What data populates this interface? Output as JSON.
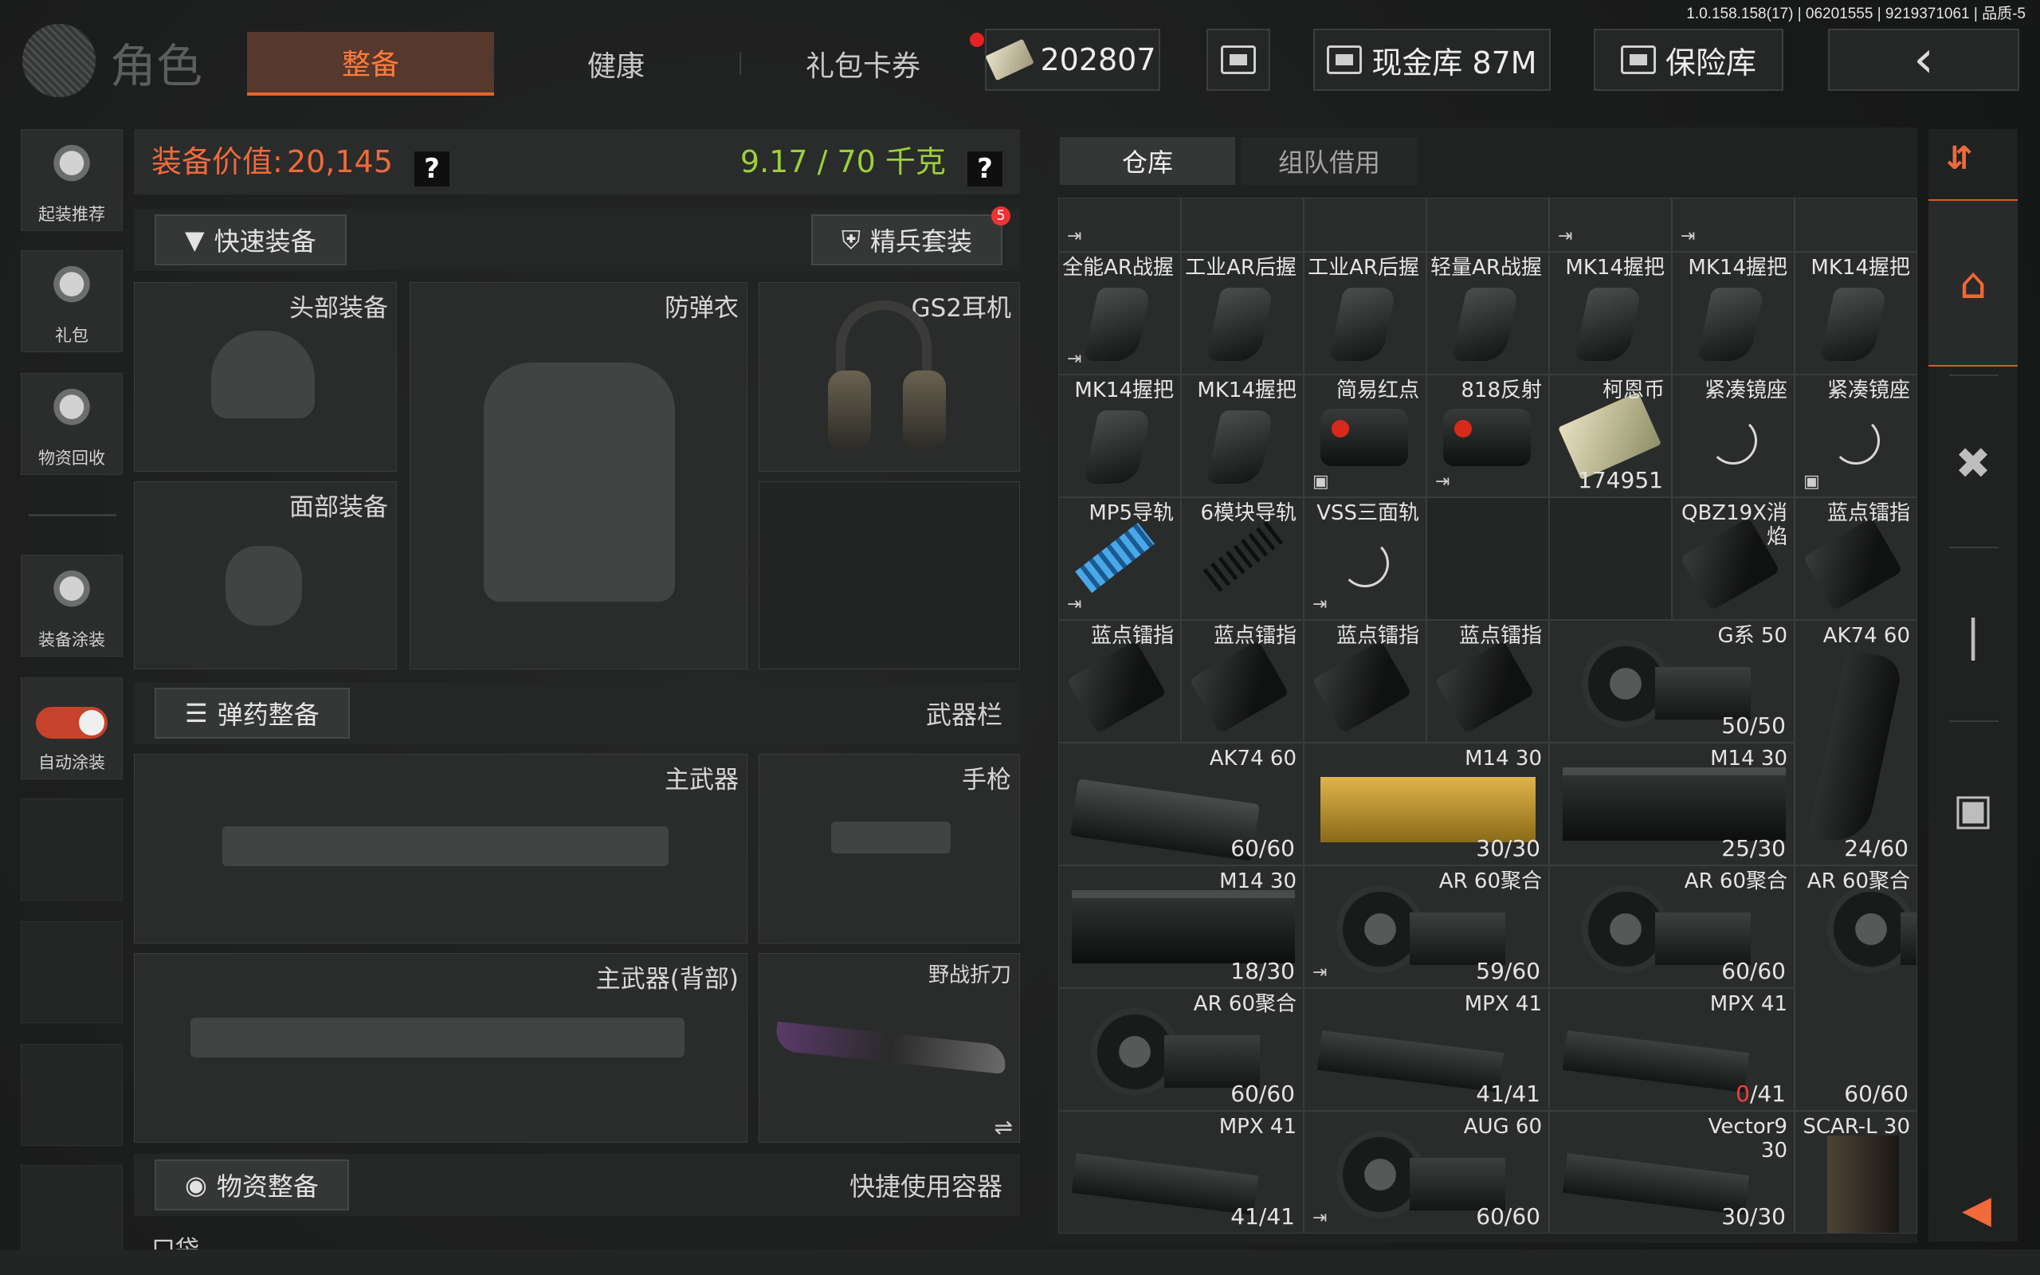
{
  "version": "1.0.158.158(17) | 06201555 | 9219371061 | 品质-5",
  "header": {
    "title": "角色",
    "tabs": [
      {
        "label": "整备",
        "active": true
      },
      {
        "label": "健康",
        "active": false
      },
      {
        "label": "礼包卡券",
        "active": false
      }
    ],
    "currency": "202807",
    "cash_vault": "现金库 87M",
    "safe": "保险库"
  },
  "sidebar": {
    "items": [
      {
        "label": "起装推荐",
        "icon": "loadout-icon"
      },
      {
        "label": "礼包",
        "icon": "gift-icon"
      },
      {
        "label": "物资回收",
        "icon": "recycle-icon"
      },
      {
        "label": "装备涂装",
        "icon": "paint-icon"
      },
      {
        "label": "自动涂装",
        "icon": "toggle-icon",
        "toggle_on": true
      }
    ]
  },
  "loadout": {
    "value_label": "装备价值:",
    "value": "20,145",
    "weight": "9.17 / 70 千克",
    "help": "?",
    "quick_equip": "快速装备",
    "elite_set": "精兵套装",
    "elite_badge": "5",
    "slots": {
      "head": "头部装备",
      "armor": "防弹衣",
      "headset": "GS2耳机",
      "face": "面部装备"
    },
    "ammo_button": "弹药整备",
    "weapon_bar": "武器栏",
    "primary": "主武器",
    "pistol": "手枪",
    "primary_back": "主武器(背部)",
    "knife": "野战折刀",
    "swap_icon": "⇌",
    "supply_button": "物资整备",
    "quick_container": "快捷使用容器",
    "pocket": "口袋"
  },
  "storage": {
    "tabs": [
      {
        "label": "仓库",
        "active": true
      },
      {
        "label": "组队借用",
        "active": false
      }
    ],
    "items": [
      {
        "name": "全能AR战握",
        "count": "",
        "art": "grip",
        "corner": "tr"
      },
      {
        "name": "工业AR后握",
        "count": "",
        "art": "grip"
      },
      {
        "name": "工业AR后握",
        "count": "",
        "art": "grip"
      },
      {
        "name": "轻量AR战握",
        "count": "",
        "art": "grip"
      },
      {
        "name": "MK14握把",
        "count": "",
        "art": "grip"
      },
      {
        "name": "MK14握把",
        "count": "",
        "art": "grip"
      },
      {
        "name": "MK14握把",
        "count": "",
        "art": "grip"
      },
      {
        "name": "MK14握把",
        "count": "",
        "art": "grip"
      },
      {
        "name": "MK14握把",
        "count": "",
        "art": "grip"
      },
      {
        "name": "简易红点",
        "count": "",
        "art": "sight"
      },
      {
        "name": "818反射",
        "count": "",
        "art": "sight"
      },
      {
        "name": "柯恩币",
        "count": "174951",
        "art": "money"
      },
      {
        "name": "紧凑镜座",
        "count": "",
        "art": "spinner"
      },
      {
        "name": "紧凑镜座",
        "count": "",
        "art": "spinner"
      },
      {
        "name": "MP5导轨",
        "count": "",
        "art": "rail-blue"
      },
      {
        "name": "6模块导轨",
        "count": "",
        "art": "rail"
      },
      {
        "name": "VSS三面轨",
        "count": "",
        "art": "spinner"
      },
      {
        "name": "QBZ19X消焰",
        "count": "",
        "art": "flash"
      },
      {
        "name": "蓝点镭指",
        "count": "",
        "art": "flash"
      },
      {
        "name": "蓝点镭指",
        "count": "",
        "art": "flash"
      },
      {
        "name": "蓝点镭指",
        "count": "",
        "art": "flash"
      },
      {
        "name": "蓝点镭指",
        "count": "",
        "art": "flash"
      },
      {
        "name": "蓝点镭指",
        "count": "",
        "art": "flash"
      },
      {
        "name": "G系 50",
        "count": "50/50",
        "art": "drum"
      },
      {
        "name": "AK74 60",
        "count": "24/60",
        "art": "mag-vert"
      },
      {
        "name": "AK74 60",
        "count": "60/60",
        "art": "mag"
      },
      {
        "name": "M14 30",
        "count": "30/30",
        "art": "gold"
      },
      {
        "name": "M14 30",
        "count": "25/30",
        "art": "box"
      },
      {
        "name": "M14 30",
        "count": "18/30",
        "art": "box"
      },
      {
        "name": "AR 60聚合",
        "count": "59/60",
        "art": "drum"
      },
      {
        "name": "AR 60聚合",
        "count": "60/60",
        "art": "drum"
      },
      {
        "name": "AR 60聚合",
        "count": "60/60",
        "art": "drum"
      },
      {
        "name": "AR 60聚合",
        "count": "60/60",
        "art": "drum"
      },
      {
        "name": "MPX 41",
        "count": "41/41",
        "art": "mag-long"
      },
      {
        "name": "MPX 41",
        "count_red": "0",
        "count_rest": "/41",
        "art": "mag-long"
      },
      {
        "name": "MPX 41",
        "count": "41/41",
        "art": "mag-long"
      },
      {
        "name": "AUG 60",
        "count": "60/60",
        "art": "drum"
      },
      {
        "name": "Vector9 30",
        "count": "30/30",
        "art": "mag-long"
      },
      {
        "name": "SCAR-L 30",
        "count": "",
        "art": "mag-scar"
      }
    ]
  },
  "right_bar": {
    "sort_icon": "sort-icon",
    "items": [
      "home-icon",
      "medkit-icon",
      "magazine-icon",
      "box-icon"
    ],
    "collapse_icon": "collapse-left-icon"
  },
  "colors": {
    "accent": "#f06a3a",
    "weight_ok": "#9bd03a",
    "tab_active_bg": "#57382c"
  }
}
